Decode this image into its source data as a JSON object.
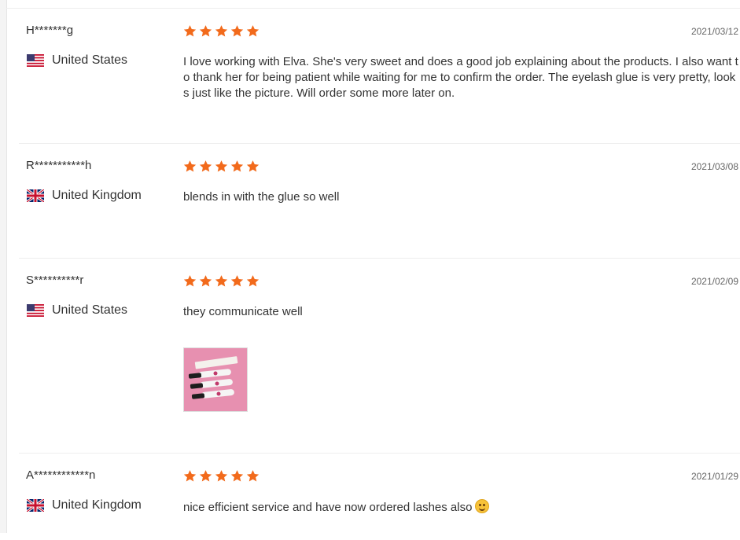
{
  "colors": {
    "star": "#f26a1b",
    "divider": "#eeeeee"
  },
  "reviews": [
    {
      "name": "H*******g",
      "country": "United States",
      "flag": "us-flag-icon",
      "rating": 5,
      "date": "2021/03/12",
      "text": "I love working with Elva. She's very sweet and does a good job explaining about the products. I also want to thank her for being patient while waiting for me to confirm the order. The eyelash glue is very pretty, looks just like the picture. Will order some more later on."
    },
    {
      "name": "R***********h",
      "country": "United Kingdom",
      "flag": "uk-flag-icon",
      "rating": 5,
      "date": "2021/03/08",
      "text": "blends in with the glue so well"
    },
    {
      "name": "S**********r",
      "country": "United States",
      "flag": "us-flag-icon",
      "rating": 5,
      "date": "2021/02/09",
      "text": "they communicate well",
      "has_photo": true
    },
    {
      "name": "A************n",
      "country": "United Kingdom",
      "flag": "uk-flag-icon",
      "rating": 5,
      "date": "2021/01/29",
      "text": "nice efficient service and have now ordered lashes also",
      "emoji": "smiling-face-icon"
    }
  ]
}
